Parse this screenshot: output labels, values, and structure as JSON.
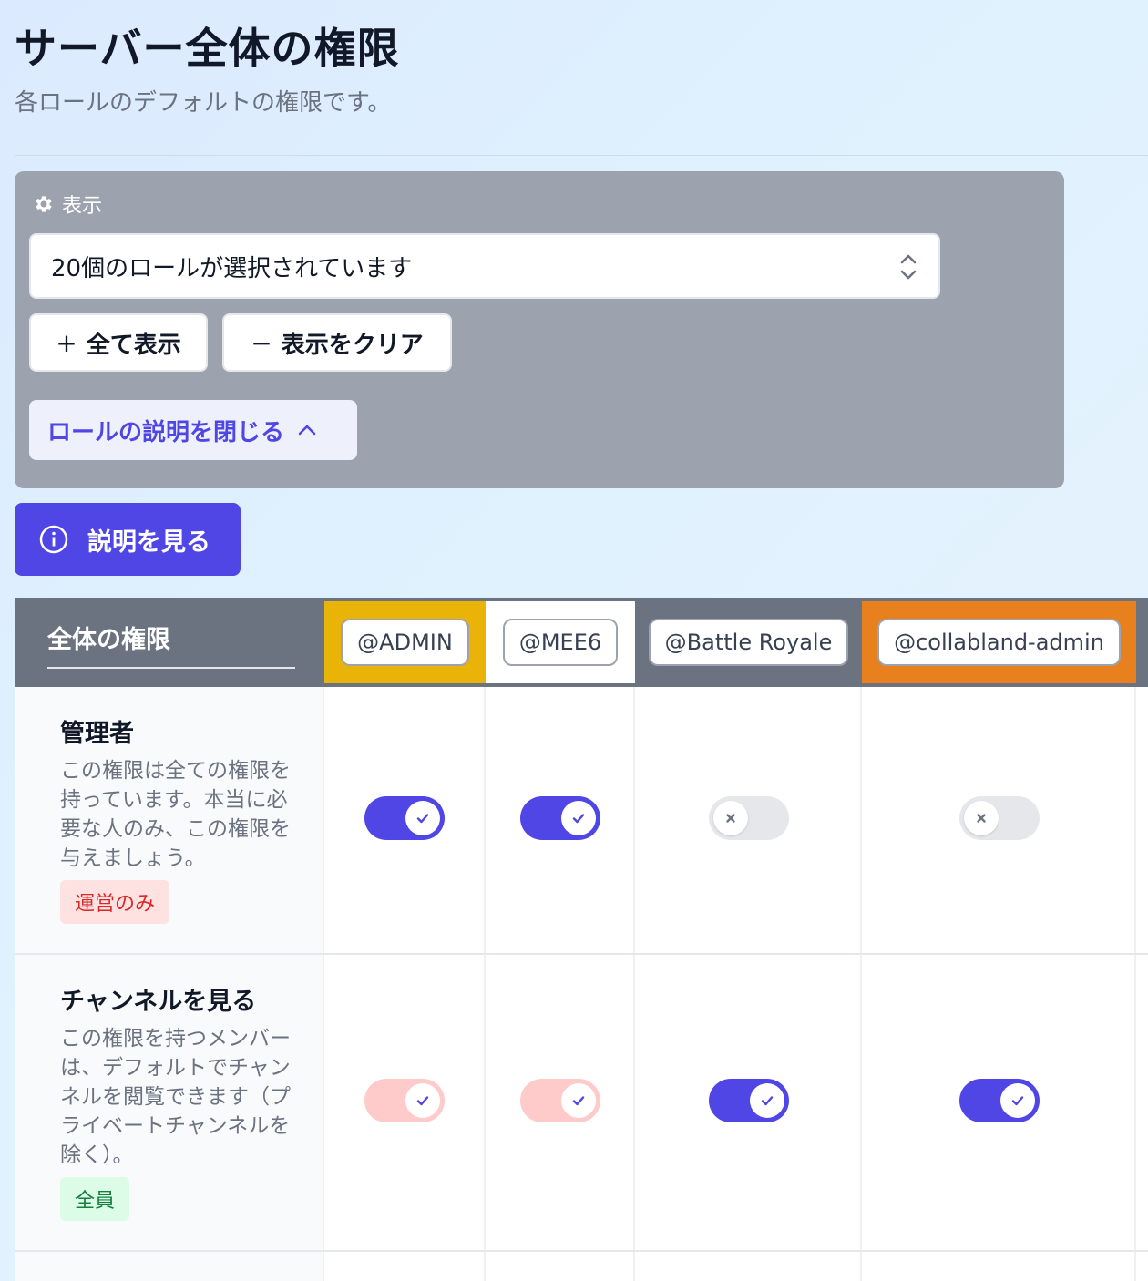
{
  "header": {
    "title": "サーバー全体の権限",
    "subtitle": "各ロールのデフォルトの権限です。"
  },
  "display_panel": {
    "label": "表示",
    "label_icon": "gear-icon",
    "select_value": "20個のロールが選択されています",
    "show_all_symbol": "+",
    "show_all_label": "全て表示",
    "clear_symbol": "−",
    "clear_label": "表示をクリア",
    "collapse_label": "ロールの説明を閉じる",
    "collapse_icon": "chevron-up-icon"
  },
  "explain_button": {
    "label": "説明を見る",
    "icon": "info-icon"
  },
  "table": {
    "header_title": "全体の権限",
    "roles": [
      {
        "label": "@ADMIN",
        "color": "#eab308"
      },
      {
        "label": "@MEE6",
        "color": "#ffffff"
      },
      {
        "label": "@Battle Royale",
        "color": "#6b7280"
      },
      {
        "label": "@collabland-admin",
        "color": "#e8801e"
      }
    ],
    "rows": [
      {
        "name": "管理者",
        "description": "この権限は全ての権限を持っています。本当に必要な人のみ、この権限を与えましょう。",
        "tag": "運営のみ",
        "tag_color": "#dc2626",
        "states": [
          "on",
          "on",
          "off",
          "off"
        ]
      },
      {
        "name": "チャンネルを見る",
        "description": "この権限を持つメンバーは、デフォルトでチャンネルを閲覧できます（プライベートチャンネルを除く）。",
        "tag": "全員",
        "tag_color": "#15803d",
        "states": [
          "on-faded",
          "on-faded",
          "on",
          "on"
        ]
      }
    ]
  },
  "colors": {
    "accent": "#4f46e5",
    "panel_bg": "#9ca3af",
    "table_header_bg": "#6b7280"
  }
}
